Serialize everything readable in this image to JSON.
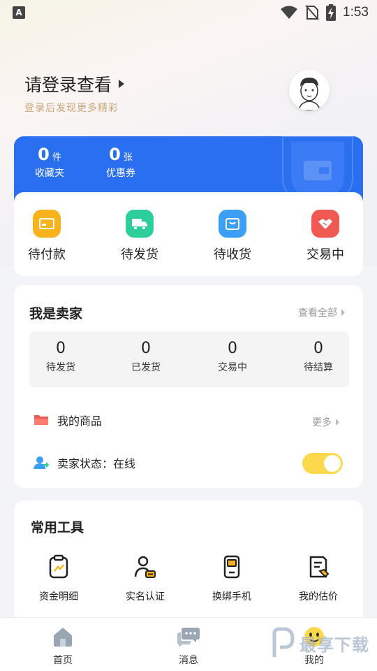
{
  "status_bar": {
    "time": "1:53",
    "notification_icon": "A"
  },
  "header": {
    "login_title": "请登录查看",
    "login_subtitle": "登录后发现更多精彩"
  },
  "account_stats": [
    {
      "value": "0",
      "unit": "件",
      "label": "收藏夹"
    },
    {
      "value": "0",
      "unit": "张",
      "label": "优惠券"
    }
  ],
  "orders": [
    {
      "label": "待付款",
      "icon": "wallet-card-icon",
      "color": "#f7b21c"
    },
    {
      "label": "待发货",
      "icon": "truck-icon",
      "color": "#2ccf9a"
    },
    {
      "label": "待收货",
      "icon": "box-icon",
      "color": "#3ba0f5"
    },
    {
      "label": "交易中",
      "icon": "handshake-icon",
      "color": "#f05a52"
    }
  ],
  "seller": {
    "title": "我是卖家",
    "view_all": "查看全部",
    "stats": [
      {
        "value": "0",
        "label": "待发货"
      },
      {
        "value": "0",
        "label": "已发货"
      },
      {
        "value": "0",
        "label": "交易中"
      },
      {
        "value": "0",
        "label": "待结算"
      }
    ],
    "my_products": "我的商品",
    "more": "更多",
    "status_label": "卖家状态：在线",
    "online": true
  },
  "tools": {
    "title": "常用工具",
    "items": [
      {
        "label": "资金明细",
        "icon": "fund-detail-icon"
      },
      {
        "label": "实名认证",
        "icon": "identity-icon"
      },
      {
        "label": "换绑手机",
        "icon": "phone-icon"
      },
      {
        "label": "我的估价",
        "icon": "valuation-icon"
      }
    ]
  },
  "tabbar": [
    {
      "label": "首页",
      "icon": "home-icon"
    },
    {
      "label": "消息",
      "icon": "message-icon"
    },
    {
      "label": "我的",
      "icon": "smile-icon",
      "active": true
    }
  ],
  "watermark": {
    "text": "最享下载"
  },
  "colors": {
    "primary_blue": "#2a6ff0",
    "accent_yellow": "#fbd94a",
    "subtitle_gold": "#c9a77a"
  }
}
